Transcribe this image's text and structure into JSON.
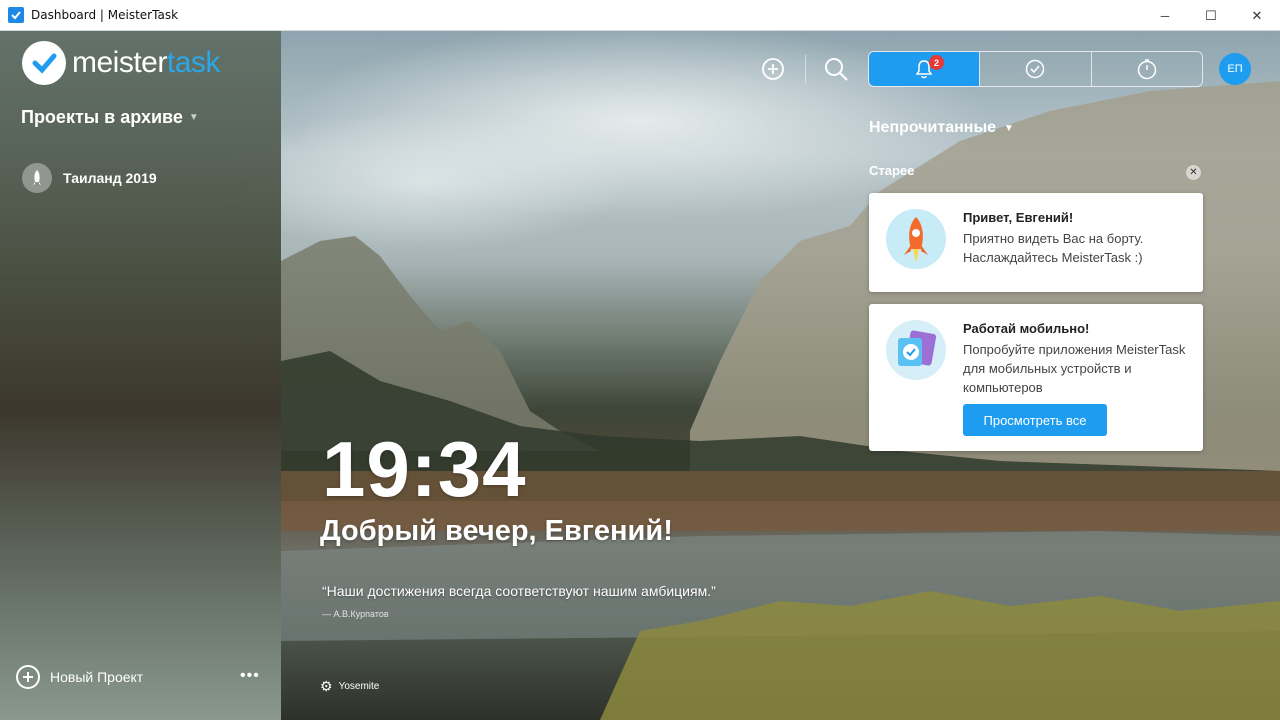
{
  "window": {
    "title": "Dashboard | MeisterTask",
    "minimize_glyph": "─",
    "maximize_glyph": "☐",
    "close_glyph": "✕"
  },
  "sidebar": {
    "logo": {
      "word_meister": "meister",
      "word_task": "task"
    },
    "section_title": "Проекты в архиве",
    "projects": [
      {
        "label": "Таиланд 2019",
        "icon": "rocket-icon"
      }
    ],
    "new_project_label": "Новый Проект",
    "more_label": "•••"
  },
  "toolbar": {
    "icons": [
      "add-icon",
      "search-icon",
      "bell-icon",
      "check-icon",
      "stopwatch-icon"
    ],
    "notification_count": "2",
    "avatar_initials": "ЕП"
  },
  "notifications": {
    "filter_label": "Непрочитанные",
    "group_label": "Старее",
    "dismiss_glyph": "✕",
    "cards": [
      {
        "title": "Привет, Евгений!",
        "body": "Приятно видеть Вас на борту. Наслаждайтесь MeisterTask :)",
        "icon": "rocket-icon"
      },
      {
        "title": "Работай мобильно!",
        "body": "Попробуйте приложения MeisterTask для мобильных устройств и компьютеров",
        "button_label": "Просмотреть все",
        "icon": "devices-icon"
      }
    ]
  },
  "hero": {
    "time": "19:34",
    "greeting": "Добрый вечер, Евгений!",
    "quote": "“Наши достижения всегда соответствуют нашим амбициям.”",
    "quote_author": "— А.В.Курпатов",
    "background_name": "Yosemite"
  },
  "colors": {
    "accent": "#1e9cf0",
    "badge": "#e53935",
    "logo_task": "#2aa8e8"
  }
}
